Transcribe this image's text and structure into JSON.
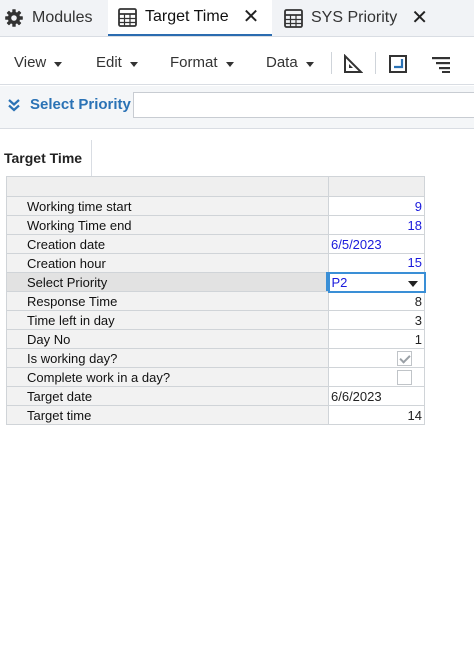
{
  "tabs": [
    {
      "label": "Modules",
      "icon": "gear-icon",
      "active": false,
      "closable": false
    },
    {
      "label": "Target Time",
      "icon": "grid-icon",
      "active": true,
      "closable": true
    },
    {
      "label": "SYS Priority",
      "icon": "grid-icon",
      "active": false,
      "closable": true
    }
  ],
  "toolbar": {
    "view": "View",
    "edit": "Edit",
    "format": "Format",
    "data": "Data"
  },
  "filter": {
    "label": "Select Priority",
    "value": ""
  },
  "section_title": "Target Time",
  "rows": [
    {
      "label": "Working time start",
      "value": "9",
      "type": "number",
      "color": "blue"
    },
    {
      "label": "Working Time end",
      "value": "18",
      "type": "number",
      "color": "blue"
    },
    {
      "label": "Creation date",
      "value": "6/5/2023",
      "type": "text",
      "color": "blue"
    },
    {
      "label": "Creation hour",
      "value": "15",
      "type": "number",
      "color": "blue"
    },
    {
      "label": "Select Priority",
      "value": "P2",
      "type": "dropdown",
      "color": "blue"
    },
    {
      "label": "Response Time",
      "value": "8",
      "type": "number",
      "color": "black"
    },
    {
      "label": "Time left in day",
      "value": "3",
      "type": "number",
      "color": "black"
    },
    {
      "label": "Day No",
      "value": "1",
      "type": "number",
      "color": "black"
    },
    {
      "label": "Is working day?",
      "value": true,
      "type": "checkbox"
    },
    {
      "label": "Complete work in a day?",
      "value": false,
      "type": "checkbox"
    },
    {
      "label": "Target date",
      "value": "6/6/2023",
      "type": "text",
      "color": "black"
    },
    {
      "label": "Target time",
      "value": "14",
      "type": "number",
      "color": "black"
    }
  ],
  "colors": {
    "accent": "#2a72b5",
    "input_value": "#1a1adc",
    "focus": "#3a8fd6"
  }
}
